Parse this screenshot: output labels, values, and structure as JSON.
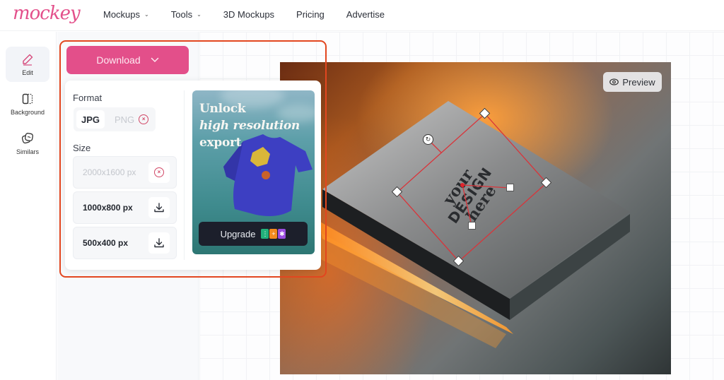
{
  "brand": {
    "logo_text": "mockey",
    "accent": "#e34f8a"
  },
  "nav": {
    "items": [
      {
        "label": "Mockups",
        "has_dropdown": true
      },
      {
        "label": "Tools",
        "has_dropdown": true
      },
      {
        "label": "3D Mockups",
        "has_dropdown": false
      },
      {
        "label": "Pricing",
        "has_dropdown": false
      },
      {
        "label": "Advertise",
        "has_dropdown": false
      }
    ]
  },
  "rail": {
    "items": [
      {
        "label": "Edit",
        "icon": "pencil-icon",
        "active": true
      },
      {
        "label": "Background",
        "icon": "background-icon",
        "active": false
      },
      {
        "label": "Similars",
        "icon": "similars-icon",
        "active": false
      }
    ]
  },
  "download": {
    "button_label": "Download",
    "format_label": "Format",
    "formats": [
      {
        "label": "JPG",
        "selected": true,
        "locked": false
      },
      {
        "label": "PNG",
        "selected": false,
        "locked": true
      }
    ],
    "size_label": "Size",
    "sizes": [
      {
        "label": "2000x1600 px",
        "locked": true
      },
      {
        "label": "1000x800 px",
        "locked": false
      },
      {
        "label": "500x400 px",
        "locked": false
      }
    ],
    "promo": {
      "line1": "Unlock",
      "line2": "high resolution",
      "line3": "export",
      "upgrade_label": "Upgrade",
      "badge_colors": [
        "#22b07a",
        "#f28a1e",
        "#9b4de0"
      ]
    }
  },
  "canvas": {
    "preview_label": "Preview",
    "design_text": {
      "line1": "your",
      "line2": "DESIGN",
      "line3": "here"
    },
    "selection_color": "#d9343a"
  }
}
